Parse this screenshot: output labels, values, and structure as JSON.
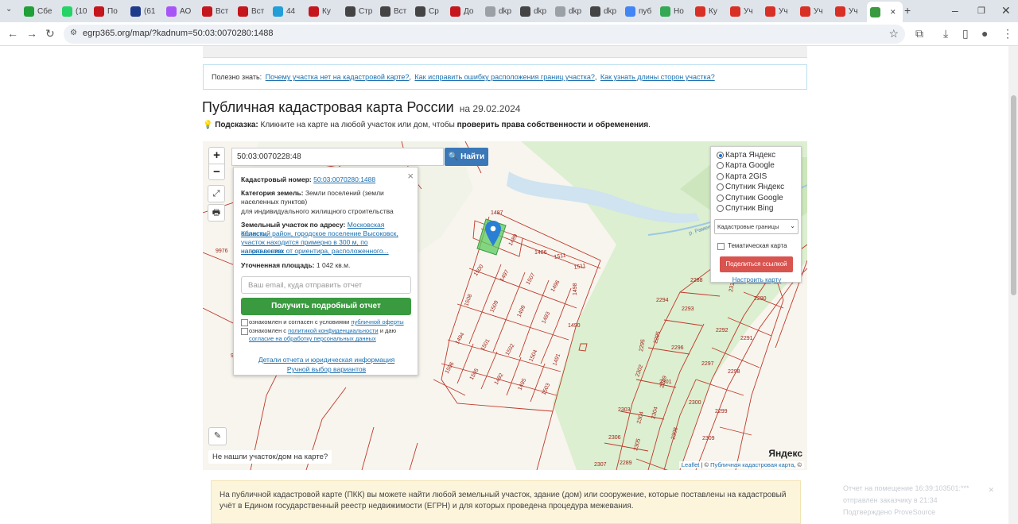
{
  "tabs": [
    {
      "label": "Сбе",
      "color": "#21a038"
    },
    {
      "label": "(10",
      "color": "#25d366"
    },
    {
      "label": "По",
      "color": "#c4161c"
    },
    {
      "label": "(61",
      "color": "#1e3a8a"
    },
    {
      "label": "АО",
      "color": "#a855f7"
    },
    {
      "label": "Вст",
      "color": "#c4161c"
    },
    {
      "label": "Вст",
      "color": "#c4161c"
    },
    {
      "label": "44",
      "color": "#229ed9"
    },
    {
      "label": "Ку",
      "color": "#c4161c"
    },
    {
      "label": "Стр",
      "color": "#444"
    },
    {
      "label": "Вст",
      "color": "#444"
    },
    {
      "label": "Ср",
      "color": "#444"
    },
    {
      "label": "До",
      "color": "#c4161c"
    },
    {
      "label": "dkp",
      "color": "#9aa0a6"
    },
    {
      "label": "dkp",
      "color": "#444"
    },
    {
      "label": "dkp",
      "color": "#9aa0a6"
    },
    {
      "label": "dkp",
      "color": "#444"
    },
    {
      "label": "пуб",
      "color": "#4285f4"
    },
    {
      "label": "Но",
      "color": "#34a853"
    },
    {
      "label": "Ку",
      "color": "#d93025"
    },
    {
      "label": "Уч",
      "color": "#d93025"
    },
    {
      "label": "Уч",
      "color": "#d93025"
    },
    {
      "label": "Уч",
      "color": "#d93025"
    },
    {
      "label": "Уч",
      "color": "#d93025"
    },
    {
      "label": "",
      "color": "#3a9a3f"
    }
  ],
  "url": "egrp365.org/map/?kadnum=50:03:0070280:1488",
  "tip": {
    "label": "Полезно знать:",
    "links": [
      "Почему участка нет на кадастровой карте?",
      "Как исправить ошибку расположения границ участка?",
      "Как узнать длины сторон участка?"
    ]
  },
  "title": "Публичная кадастровая карта России",
  "date": "на 29.02.2024",
  "hint": {
    "label": "Подсказка:",
    "text": "Кликните на карте на любой участок или дом, чтобы",
    "bold": "проверить права собственности и обременения",
    "end": "."
  },
  "search": {
    "value": "50:03:0070228:48",
    "button": "Найти"
  },
  "popup": {
    "cad_label": "Кадастровый номер:",
    "cad_value": "50:03:0070280:1488",
    "cat_label": "Категория земель:",
    "cat_value": "Земли поселений (земли",
    "cat_value2": "населенных пунктов)",
    "cat_use": "для индивидуального жилищного строительства",
    "addr_label": "Земельный участок по адресу:",
    "addr1": "Московская область,",
    "addr2": "Клинский район, городское поселение Высоковск,",
    "addr3": "участок находится примерно в 300 м, по направлению",
    "addr4": "на юго-восток от ориентира, расположенного...",
    "area_label": "Уточненная площадь:",
    "area_value": "1 042 кв.м.",
    "email_placeholder": "Ваш email, куда отправить отчет",
    "report_button": "Получить подробный отчет",
    "agree1_a": "ознакомлен и согласен с условиями",
    "agree1_link": "публичной оферты",
    "agree2_a": "ознакомлен с",
    "agree2_link": "политикой конфиденциальности",
    "agree2_b": "и даю",
    "agree2_link2": "согласие на обработку персональных данных",
    "details_link": "Детали отчета и юридическая информация",
    "manual_link": "Ручной выбор вариантов"
  },
  "layers": {
    "options": [
      {
        "label": "Карта Яндекс",
        "selected": true
      },
      {
        "label": "Карта Google",
        "selected": false
      },
      {
        "label": "Карта 2GIS",
        "selected": false
      },
      {
        "label": "Спутник Яндекс",
        "selected": false
      },
      {
        "label": "Спутник Google",
        "selected": false
      },
      {
        "label": "Спутник Bing",
        "selected": false
      }
    ],
    "select_value": "Кадастровые границы",
    "thematic": "Тематическая карта",
    "share_button": "Поделиться ссылкой",
    "tune_link": "Настроить карту"
  },
  "map": {
    "not_found": "Не нашли участок/дом на карте?",
    "logo": "Яндекс",
    "attr_leaflet": "Leaflet",
    "attr_sep": " | © ",
    "attr_pkk": "Публичная кадастровая карта",
    "attr_end": ", ©",
    "road_label": "р. Рамен",
    "parcels": [
      "9976",
      "99",
      "1487",
      "1489",
      "1486",
      "1511",
      "1511",
      "1500",
      "1497",
      "1507",
      "1496",
      "1498",
      "1508",
      "1509",
      "1499",
      "1493",
      "1490",
      "1494",
      "1501",
      "1502",
      "1504",
      "1491",
      "1506",
      "1505",
      "1492",
      "1495",
      "1503",
      "2288",
      "2310",
      "2290",
      "2294",
      "2293",
      "2292",
      "2291",
      "2295",
      "2295",
      "2296",
      "2297",
      "2298",
      "2289",
      "2302",
      "2301",
      "2300",
      "2299",
      "2303",
      "2304",
      "2304",
      "2308",
      "2309",
      "2306",
      "2305",
      "2307",
      "2289"
    ],
    "colors": {
      "line": "#c0392b",
      "green": "#dcefd0",
      "water": "#cfe3f0",
      "selected": "#5ccb5c",
      "marker": "#2a7fd4"
    }
  },
  "info": "На публичной кадастровой карте (ПКК) вы можете найти любой земельный участок, здание (дом) или сооружение, которые поставлены на кадастровый учёт в Едином государственный реестр недвижимости (ЕГРН) и для которых проведена процедура межевания.",
  "toast": {
    "line1": "Отчет на помещение 16:39:103501:***",
    "line2": "отправлен заказчику в 21:34",
    "line3": "Подтверждено ProveSource"
  }
}
